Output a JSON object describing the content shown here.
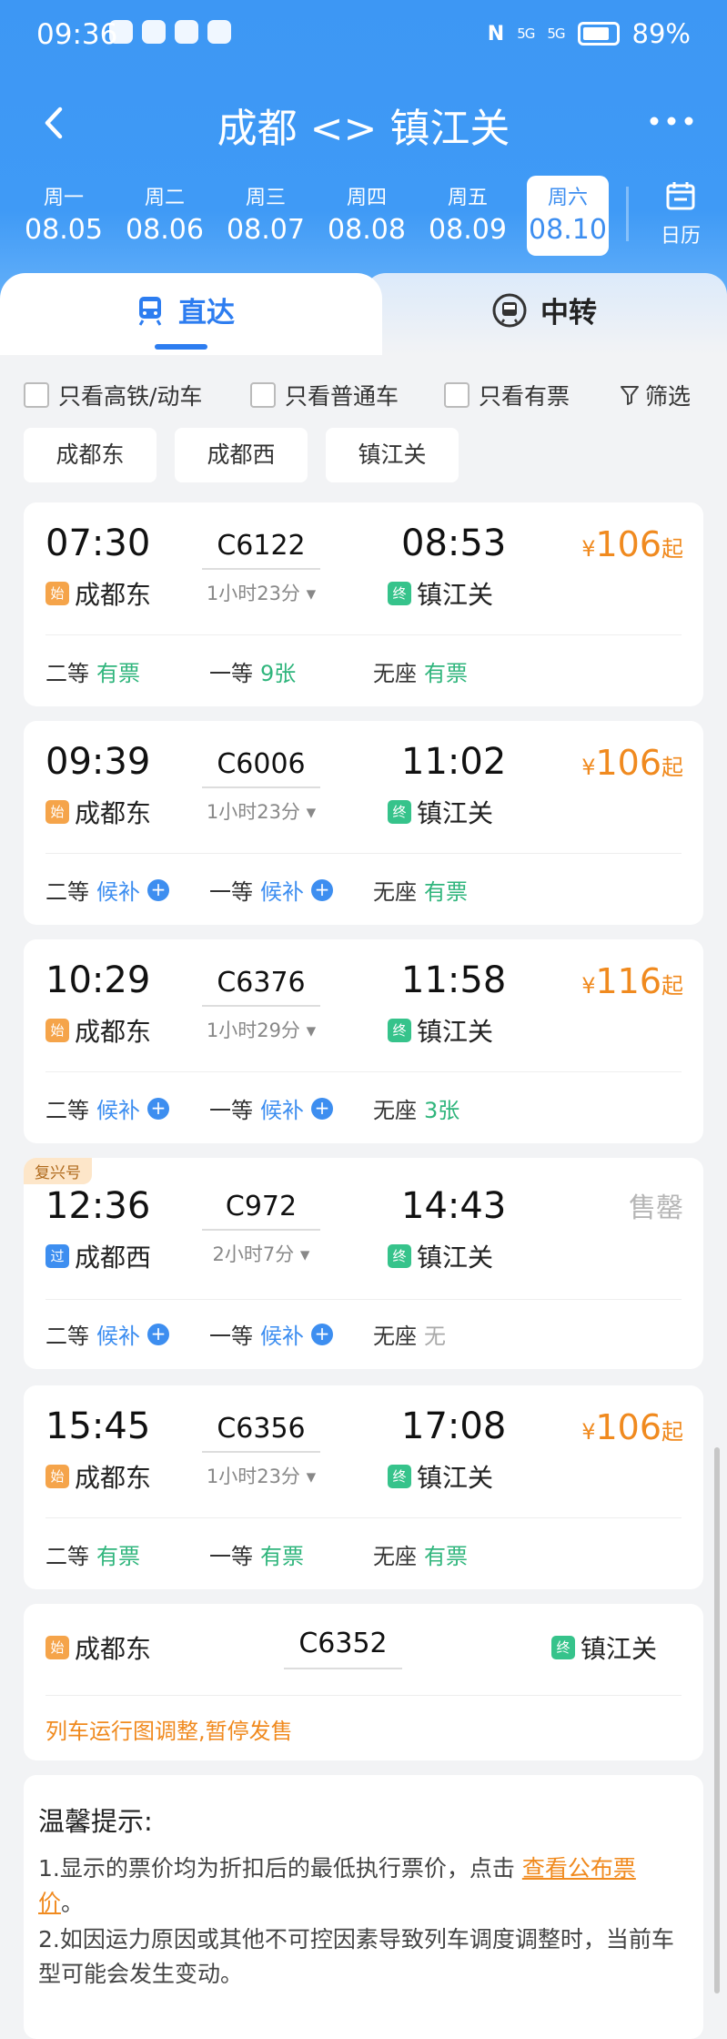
{
  "status_bar": {
    "time": "09:36",
    "battery": "89%",
    "signal1": "5G",
    "signal2": "5G"
  },
  "nav": {
    "title": "成都 <> 镇江关"
  },
  "dates": [
    {
      "weekday": "周一",
      "date": "08.05"
    },
    {
      "weekday": "周二",
      "date": "08.06"
    },
    {
      "weekday": "周三",
      "date": "08.07"
    },
    {
      "weekday": "周四",
      "date": "08.08"
    },
    {
      "weekday": "周五",
      "date": "08.09"
    },
    {
      "weekday": "周六",
      "date": "08.10",
      "active": true
    }
  ],
  "calendar_label": "日历",
  "tabs": {
    "direct": "直达",
    "transfer": "中转"
  },
  "filters": {
    "high_speed": "只看高铁/动车",
    "normal": "只看普通车",
    "available": "只看有票",
    "filter": "筛选"
  },
  "stations": [
    "成都东",
    "成都西",
    "镇江关"
  ],
  "trains": [
    {
      "dep_time": "07:30",
      "train_no": "C6122",
      "duration": "1小时23分",
      "arr_time": "08:53",
      "dep_tag": "始",
      "dep_station": "成都东",
      "arr_tag": "终",
      "arr_station": "镇江关",
      "price_cur": "¥",
      "price": "106",
      "price_sfx": "起",
      "seats": [
        {
          "class": "二等",
          "status": "有票"
        },
        {
          "class": "一等",
          "status": "9张"
        },
        {
          "class": "无座",
          "status": "有票"
        }
      ]
    },
    {
      "dep_time": "09:39",
      "train_no": "C6006",
      "duration": "1小时23分",
      "arr_time": "11:02",
      "dep_tag": "始",
      "dep_station": "成都东",
      "arr_tag": "终",
      "arr_station": "镇江关",
      "price_cur": "¥",
      "price": "106",
      "price_sfx": "起",
      "seats": [
        {
          "class": "二等",
          "status": "候补"
        },
        {
          "class": "一等",
          "status": "候补"
        },
        {
          "class": "无座",
          "status": "有票"
        }
      ]
    },
    {
      "dep_time": "10:29",
      "train_no": "C6376",
      "duration": "1小时29分",
      "arr_time": "11:58",
      "dep_tag": "始",
      "dep_station": "成都东",
      "arr_tag": "终",
      "arr_station": "镇江关",
      "price_cur": "¥",
      "price": "116",
      "price_sfx": "起",
      "seats": [
        {
          "class": "二等",
          "status": "候补"
        },
        {
          "class": "一等",
          "status": "候补"
        },
        {
          "class": "无座",
          "status": "3张"
        }
      ]
    },
    {
      "badge": "复兴号",
      "dep_time": "12:36",
      "train_no": "C972",
      "duration": "2小时7分",
      "arr_time": "14:43",
      "dep_tag": "过",
      "dep_station": "成都西",
      "arr_tag": "终",
      "arr_station": "镇江关",
      "sold_out": "售罄",
      "seats": [
        {
          "class": "二等",
          "status": "候补"
        },
        {
          "class": "一等",
          "status": "候补"
        },
        {
          "class": "无座",
          "status": "无"
        }
      ]
    },
    {
      "dep_time": "15:45",
      "train_no": "C6356",
      "duration": "1小时23分",
      "arr_time": "17:08",
      "dep_tag": "始",
      "dep_station": "成都东",
      "arr_tag": "终",
      "arr_station": "镇江关",
      "price_cur": "¥",
      "price": "106",
      "price_sfx": "起",
      "seats": [
        {
          "class": "二等",
          "status": "有票"
        },
        {
          "class": "一等",
          "status": "有票"
        },
        {
          "class": "无座",
          "status": "有票"
        }
      ]
    }
  ],
  "suspended": {
    "dep_tag": "始",
    "dep_station": "成都东",
    "train_no": "C6352",
    "arr_tag": "终",
    "arr_station": "镇江关",
    "message": "列车运行图调整,暂停发售"
  },
  "notice": {
    "title": "温馨提示:",
    "line1_prefix": "1.显示的票价均为折扣后的最低执行票价，点击 ",
    "line1_link_a": "查看公布票",
    "line1_link_b": "价",
    "line1_end": "。",
    "line2a": "2.如因运力原因或其他不可控因素导致列车调度调整时，当前车",
    "line2b": "型可能会发生变动。"
  }
}
